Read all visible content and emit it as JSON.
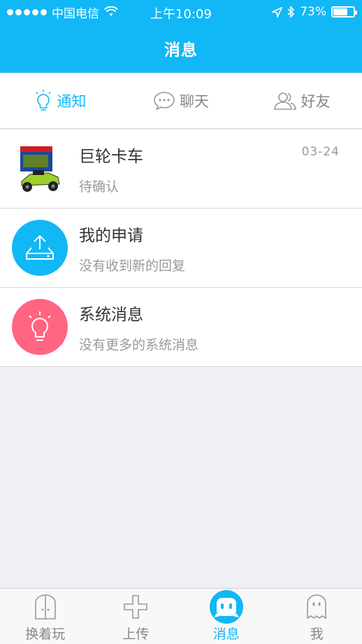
{
  "status_bar": {
    "carrier": "中国电信",
    "time": "上午10:09",
    "battery": "73%",
    "battery_level": 0.73
  },
  "header": {
    "title": "消息"
  },
  "tabs": [
    {
      "label": "通知",
      "icon": "lightbulb-icon",
      "active": true
    },
    {
      "label": "聊天",
      "icon": "chat-bubble-icon",
      "active": false
    },
    {
      "label": "好友",
      "icon": "friends-icon",
      "active": false
    }
  ],
  "messages": [
    {
      "title": "巨轮卡车",
      "subtitle": "待确认",
      "date": "03-24",
      "avatar": "toy-truck-thumbnail"
    },
    {
      "title": "我的申请",
      "subtitle": "没有收到新的回复",
      "avatar": "upload-tray-icon",
      "color": "#12b7f5"
    },
    {
      "title": "系统消息",
      "subtitle": "没有更多的系统消息",
      "avatar": "lightbulb-icon",
      "color": "#ff6580"
    }
  ],
  "tabbar": [
    {
      "label": "换着玩",
      "icon": "door-icon",
      "active": false
    },
    {
      "label": "上传",
      "icon": "plus-icon",
      "active": false
    },
    {
      "label": "消息",
      "icon": "robot-face-icon",
      "active": true
    },
    {
      "label": "我",
      "icon": "ghost-icon",
      "active": false
    }
  ],
  "colors": {
    "accent": "#12b7f5",
    "pink": "#ff6580",
    "background": "#efeff4"
  }
}
